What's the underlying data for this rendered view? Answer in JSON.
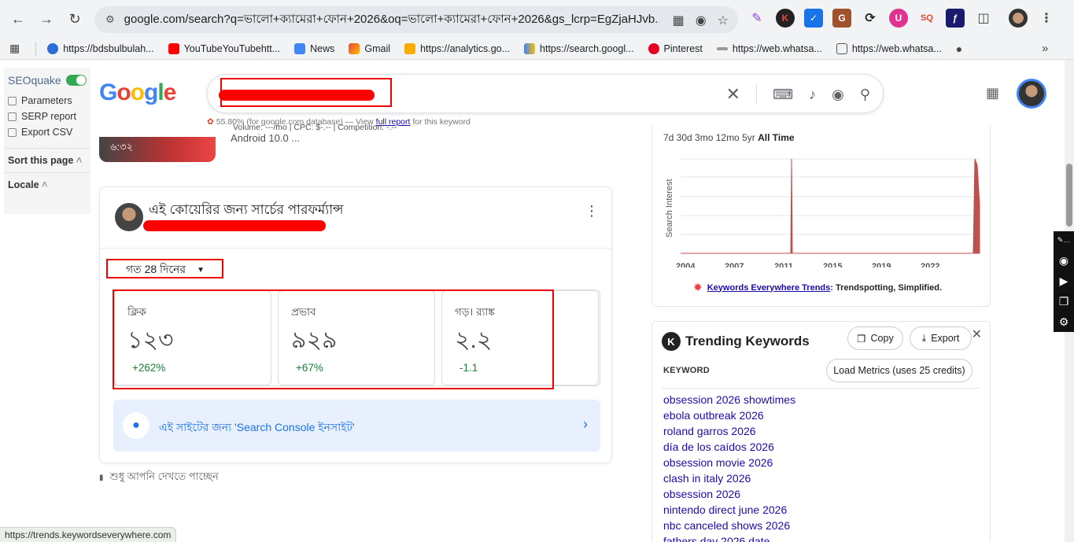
{
  "browser": {
    "url": "google.com/search?q=ভালো+ক্যামেরা+ফোন+2026&oq=ভালো+ক্যামেরা+ফোন+2026&gs_lcrp=EgZjaHJvb...",
    "bookmarks": [
      "https://bdsbulbulah...",
      "YouTubeYouTubehtt...",
      "News",
      "Gmail",
      "https://analytics.go...",
      "https://search.googl...",
      "Pinterest",
      "https://web.whatsa...",
      "https://web.whatsa..."
    ]
  },
  "seoquake": {
    "title": "SEOquake",
    "items": [
      "Parameters",
      "SERP report",
      "Export CSV"
    ],
    "sort_label": "Sort this page",
    "locale_label": "Locale"
  },
  "google": {
    "logo": "Google",
    "kwe_line_prefix": "55.80% (for google.com database) — View",
    "kwe_link": "full report",
    "kwe_line_suffix": "for this keyword",
    "kwe_line_overlap": "Volume: ---/mo | CPC: $-.-- | Competition: -.--"
  },
  "result": {
    "duration": "৬:৩২",
    "snippet": "Android 10.0 ..."
  },
  "console_card": {
    "title": "এই কোয়েরির জন্য সার্চের পারফর্ম্যান্স",
    "range_label": "গত 28 দিনের",
    "metrics": [
      {
        "label": "ক্লিক",
        "value": "১২৩",
        "delta": "+262%"
      },
      {
        "label": "প্রভাব",
        "value": "৯২৯",
        "delta": "+67%"
      },
      {
        "label": "গড়। র‍্যাঙ্ক",
        "value": "২.২",
        "delta": "-1.1"
      }
    ],
    "insight_text": "এই সাইটের জন্য 'Search Console ইনসাইট'",
    "footer": "শুধু আপনি দেখতে পাচ্ছেন"
  },
  "trends": {
    "tabs": "7d  30d  3mo  12mo  5yr",
    "tab_active": "All Time",
    "y_label": "Search Interest",
    "x_ticks": [
      "2004",
      "2007",
      "2011",
      "2015",
      "2019",
      "2022"
    ],
    "footer_link": "Keywords Everywhere Trends",
    "footer_text": ": Trendspotting, Simplified."
  },
  "trending_keywords": {
    "title": "Trending Keywords",
    "copy_label": "Copy",
    "export_label": "Export",
    "column_header": "KEYWORD",
    "load_label": "Load Metrics (uses 25 credits)",
    "items": [
      "obsession 2026 showtimes",
      "ebola outbreak 2026",
      "roland garros 2026",
      "día de los caídos 2026",
      "obsession movie 2026",
      "clash in italy 2026",
      "obsession 2026",
      "nintendo direct june 2026",
      "nbc canceled shows 2026",
      "fathers day 2026 date"
    ]
  },
  "status_url": "https://trends.keywordseverywhere.com",
  "colors": {
    "accent_blue": "#1a73e8",
    "link": "#1a0dab",
    "positive": "#188038",
    "redaction": "#ff0000",
    "trend_bar": "#c0504d"
  }
}
